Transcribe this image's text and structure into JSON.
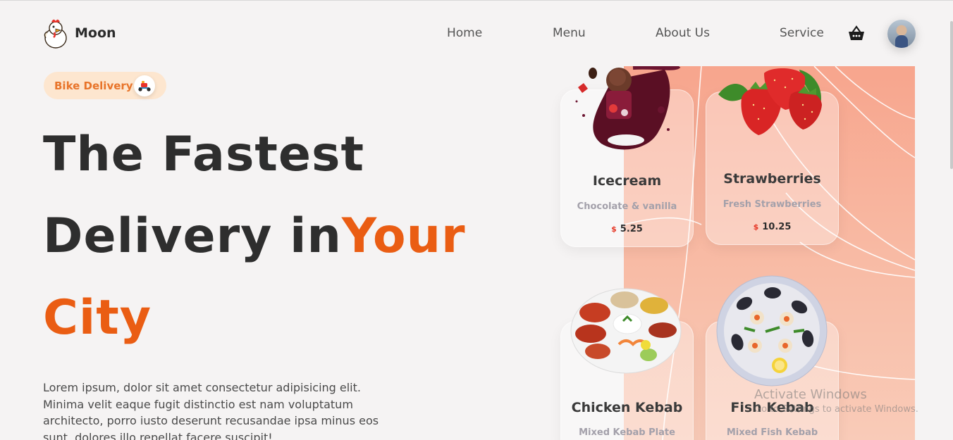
{
  "brand": {
    "name": "Moon",
    "logo_icon": "rooster-mascot-icon"
  },
  "nav": {
    "items": [
      {
        "label": "Home"
      },
      {
        "label": "Menu"
      },
      {
        "label": "About Us"
      },
      {
        "label": "Service"
      }
    ],
    "cart_icon": "basket-icon",
    "avatar_icon": "user-avatar"
  },
  "hero": {
    "badge": {
      "label": "Bike Delivery",
      "icon": "scooter-icon"
    },
    "headline_line1": "The Fastest",
    "headline_line2_prefix": "Delivery in",
    "headline_line2_accent": "Your",
    "headline_line3": "City",
    "description": "Lorem ipsum, dolor sit amet consectetur adipisicing elit. Minima velit eaque fugit distinctio est nam voluptatum architecto, porro iusto deserunt recusandae ipsa minus eos sunt, dolores illo repellat facere suscipit!"
  },
  "cards": [
    {
      "name": "Icecream",
      "desc": "Chocolate & vanilla",
      "currency": "$",
      "price": "5.25"
    },
    {
      "name": "Strawberries",
      "desc": "Fresh Strawberries",
      "currency": "$",
      "price": "10.25"
    },
    {
      "name": "Chicken Kebab",
      "desc": "Mixed Kebab Plate"
    },
    {
      "name": "Fish Kebab",
      "desc": "Mixed Fish Kebab"
    }
  ],
  "watermark": {
    "title": "Activate Windows",
    "subtitle": "Go to Settings to activate Windows."
  },
  "colors": {
    "accent": "#ea5d13",
    "badge_bg": "#fde6cf",
    "panel_top": "#f7a58d",
    "price_currency": "#e63928"
  }
}
